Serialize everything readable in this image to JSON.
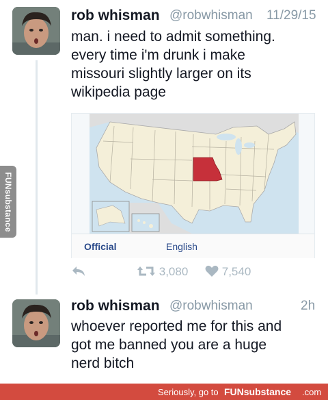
{
  "tweet1": {
    "name": "rob whisman",
    "handle": "@robwhisman",
    "date": "11/29/15",
    "lines": [
      "man. i need to admit something.",
      "every time i'm drunk i make",
      "missouri slightly larger on its",
      "wikipedia page"
    ],
    "map_tabs": [
      "Official",
      "English"
    ],
    "retweets": "3,080",
    "likes": "7,540"
  },
  "tweet2": {
    "name": "rob whisman",
    "handle": "@robwhisman",
    "date": "2h",
    "lines": [
      "whoever reported me for this and",
      "got me banned you are a huge",
      "nerd bitch"
    ]
  },
  "side_tab": "FUNsubstance",
  "footer": {
    "prefix": "Seriously, go to",
    "brand": "FUNsubstance",
    "suffix": ".com"
  },
  "colors": {
    "missouri": "#c6303a",
    "states": "#f4efd9",
    "water": "#cfe3ef",
    "footer": "#d34b3f",
    "action_icon": "#aab8c2"
  }
}
